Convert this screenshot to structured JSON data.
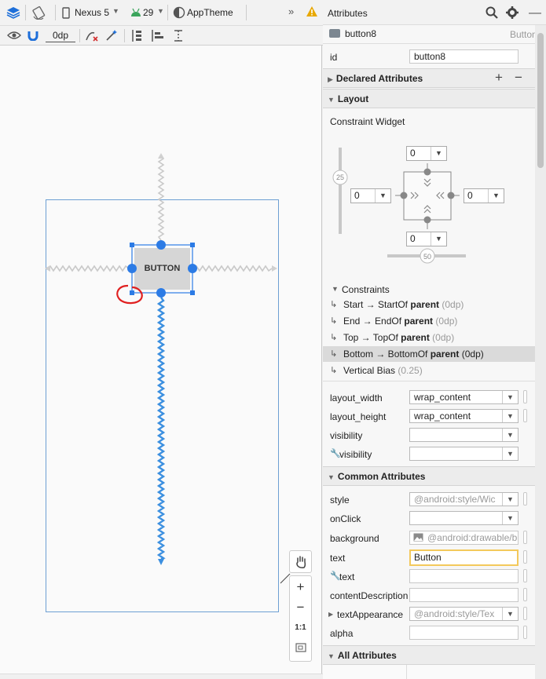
{
  "toolbar": {
    "device": "Nexus 5",
    "api": "29",
    "theme": "AppTheme",
    "more": "»",
    "margin": "0dp"
  },
  "attributes_panel": {
    "title": "Attributes",
    "component_name": "button8",
    "component_type": "Button",
    "id_label": "id",
    "id_value": "button8",
    "declared": "Declared Attributes",
    "layout": "Layout",
    "constraint_widget": "Constraint Widget",
    "margins": {
      "top": "0",
      "left": "0",
      "right": "0",
      "bottom": "0"
    },
    "bias_vertical": "25",
    "bias_horizontal": "50",
    "constraints_header": "Constraints",
    "constraints": [
      {
        "text": "Start → StartOf ",
        "bold": "parent",
        "extra": " (0dp)",
        "selected": false
      },
      {
        "text": "End → EndOf ",
        "bold": "parent",
        "extra": " (0dp)",
        "selected": false
      },
      {
        "text": "Top → TopOf ",
        "bold": "parent",
        "extra": " (0dp)",
        "selected": false
      },
      {
        "text": "Bottom → BottomOf ",
        "bold": "parent",
        "extra": " (0dp)",
        "selected": true
      },
      {
        "text": "Vertical Bias ",
        "bold": "",
        "extra": " (0.25)",
        "selected": false
      }
    ],
    "layout_attrs": [
      {
        "label": "layout_width",
        "value": "wrap_content"
      },
      {
        "label": "layout_height",
        "value": "wrap_content"
      },
      {
        "label": "visibility",
        "value": ""
      },
      {
        "label": "visibility",
        "value": ""
      }
    ],
    "common": "Common Attributes",
    "common_attrs": {
      "style_label": "style",
      "style_value": "@android:style/Wic",
      "onclick_label": "onClick",
      "onclick_value": "",
      "background_label": "background",
      "background_value": "@android:drawable/b",
      "text_label": "text",
      "text_value": "Button",
      "text2_label": "text",
      "text2_value": "",
      "contentdesc_label": "contentDescription",
      "contentdesc_value": "",
      "textappearance_label": "textAppearance",
      "textappearance_value": "@android:style/Tex",
      "alpha_label": "alpha",
      "alpha_value": ""
    },
    "all": "All Attributes"
  },
  "canvas": {
    "button_text": "BUTTON",
    "zoom_in": "+",
    "zoom_out": "−",
    "zoom_reset": "1:1"
  },
  "colors": {
    "accent": "#1e88e5",
    "selection_blue": "#2c7be5",
    "constraint_line": "#3b8fe0",
    "annotation_red": "#e02020",
    "text_field_focus": "#f3c95c"
  }
}
